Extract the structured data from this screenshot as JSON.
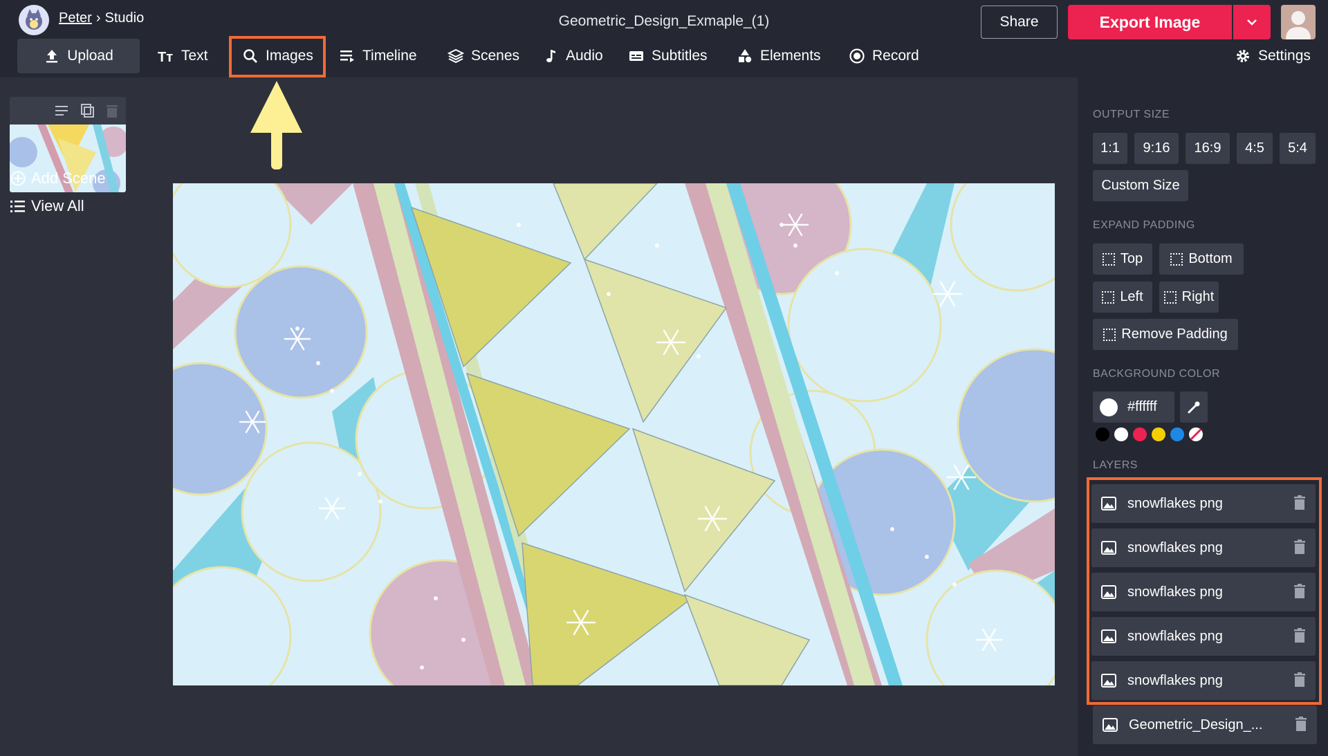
{
  "header": {
    "user_name": "Peter",
    "separator": "›",
    "section": "Studio",
    "file_name": "Geometric_Design_Exmaple_(1)",
    "share_label": "Share",
    "export_label": "Export Image"
  },
  "toolbar": {
    "upload": "Upload",
    "text": "Text",
    "images": "Images",
    "timeline": "Timeline",
    "scenes": "Scenes",
    "audio": "Audio",
    "subtitles": "Subtitles",
    "elements": "Elements",
    "record": "Record",
    "settings": "Settings"
  },
  "left_panel": {
    "add_scene": "Add Scene",
    "view_all": "View All"
  },
  "right_panel": {
    "output_size_title": "OUTPUT SIZE",
    "sizes": [
      "1:1",
      "9:16",
      "16:9",
      "4:5",
      "5:4"
    ],
    "custom_size": "Custom Size",
    "expand_padding_title": "EXPAND PADDING",
    "padding": {
      "top": "Top",
      "bottom": "Bottom",
      "left": "Left",
      "right": "Right",
      "remove": "Remove Padding"
    },
    "background_color_title": "BACKGROUND COLOR",
    "background_color_value": "#ffffff",
    "swatches": [
      "#000000",
      "#ffffff",
      "#ec2250",
      "#f5d000",
      "#1e88e5",
      "transparent"
    ],
    "layers_title": "LAYERS",
    "layers": [
      "snowflakes png",
      "snowflakes png",
      "snowflakes png",
      "snowflakes png",
      "snowflakes png",
      "Geometric_Design_..."
    ]
  },
  "colors": {
    "accent": "#ec2250",
    "highlight": "#f26a36",
    "arrow": "#fcef94",
    "topbar": "#252833",
    "workspace": "#2e313b"
  }
}
